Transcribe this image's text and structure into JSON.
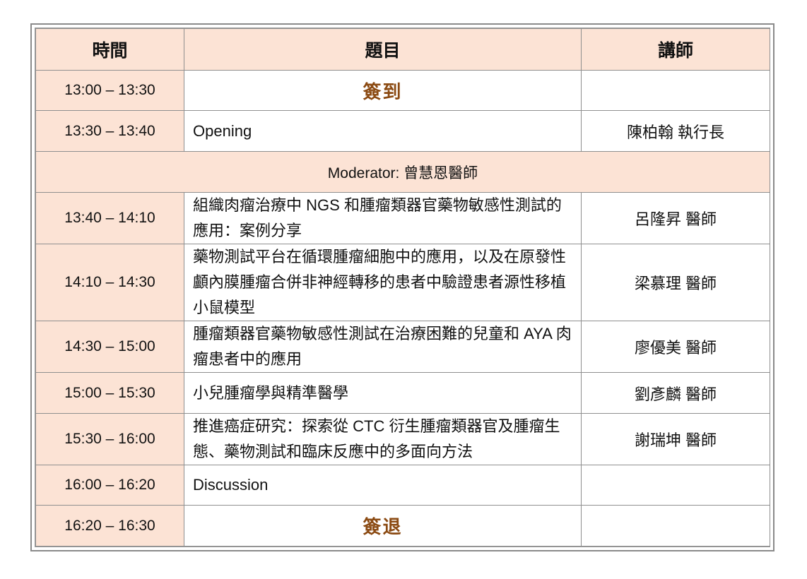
{
  "headers": {
    "time": "時間",
    "topic": "題目",
    "speaker": "講師"
  },
  "rows": [
    {
      "time": "13:00 – 13:30",
      "topic": "簽到",
      "speaker": ""
    },
    {
      "time": "13:30 – 13:40",
      "topic": "Opening",
      "speaker": "陳柏翰 執行長"
    },
    {
      "time": "13:40 – 14:10",
      "topic": "組織肉瘤治療中 NGS 和腫瘤類器官藥物敏感性測試的應用：案例分享",
      "speaker": "呂隆昇 醫師"
    },
    {
      "time": "14:10 – 14:30",
      "topic": "藥物測試平台在循環腫瘤細胞中的應用，以及在原發性顱內膜腫瘤合併非神經轉移的患者中驗證患者源性移植小鼠模型",
      "speaker": "梁慕理 醫師"
    },
    {
      "time": "14:30 – 15:00",
      "topic": "腫瘤類器官藥物敏感性測試在治療困難的兒童和 AYA 肉瘤患者中的應用",
      "speaker": "廖優美 醫師"
    },
    {
      "time": "15:00 – 15:30",
      "topic": "小兒腫瘤學與精準醫學",
      "speaker": "劉彥麟 醫師"
    },
    {
      "time": "15:30 – 16:00",
      "topic": "推進癌症研究：探索從 CTC 衍生腫瘤類器官及腫瘤生態、藥物測試和臨床反應中的多面向方法",
      "speaker": "謝瑞坤 醫師"
    },
    {
      "time": "16:00 – 16:20",
      "topic": "Discussion",
      "speaker": ""
    },
    {
      "time": "16:20 – 16:30",
      "topic": "簽退",
      "speaker": ""
    }
  ],
  "moderator": "Moderator:  曾慧恩醫師"
}
